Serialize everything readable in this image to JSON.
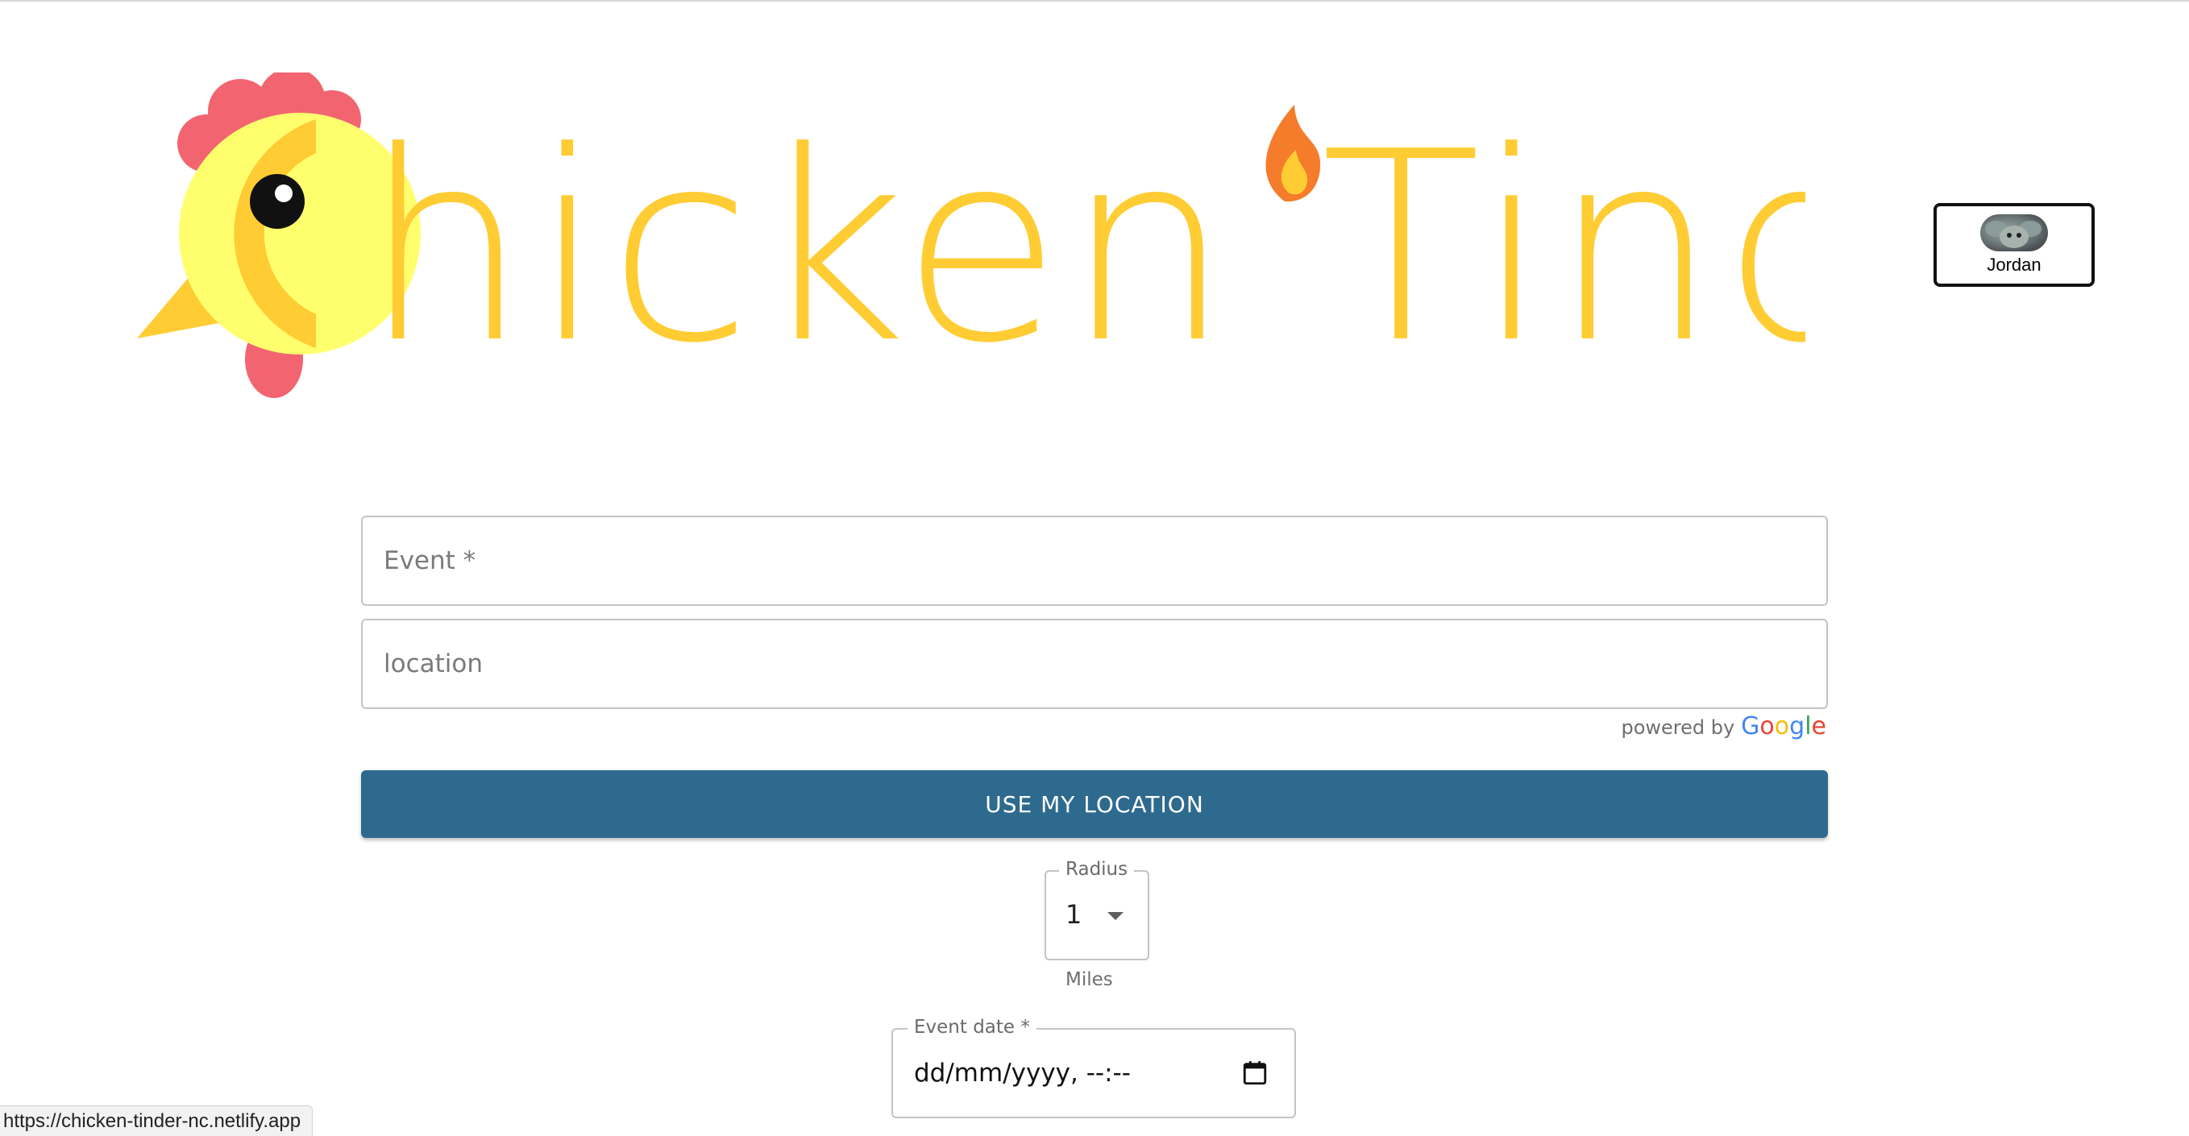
{
  "logo": {
    "text": "hicken Tinder",
    "colors": {
      "text": "#ffcc33",
      "comb": "#f26470",
      "head": "#ffff6e",
      "beak": "#ffcc33",
      "flame_outer": "#f57c2a",
      "flame_inner": "#ffcc33"
    }
  },
  "user": {
    "name": "Jordan",
    "avatar_icon": "user-avatar"
  },
  "form": {
    "event_placeholder": "Event *",
    "location_placeholder": "location",
    "powered_by": "powered by",
    "google": [
      "G",
      "o",
      "o",
      "g",
      "l",
      "e"
    ],
    "google_colors": [
      "#4285F4",
      "#EA4335",
      "#FBBC05",
      "#4285F4",
      "#34A853",
      "#EA4335"
    ],
    "use_location_label": "USE MY LOCATION",
    "radius": {
      "legend": "Radius",
      "value": "1",
      "unit": "Miles"
    },
    "event_date": {
      "legend": "Event date *",
      "value": "dd/mm/yyyy, --:--",
      "icon": "calendar-icon"
    }
  },
  "status_bar": {
    "url": "https://chicken-tinder-nc.netlify.app"
  },
  "colors": {
    "primary_button": "#2e6a8e"
  }
}
